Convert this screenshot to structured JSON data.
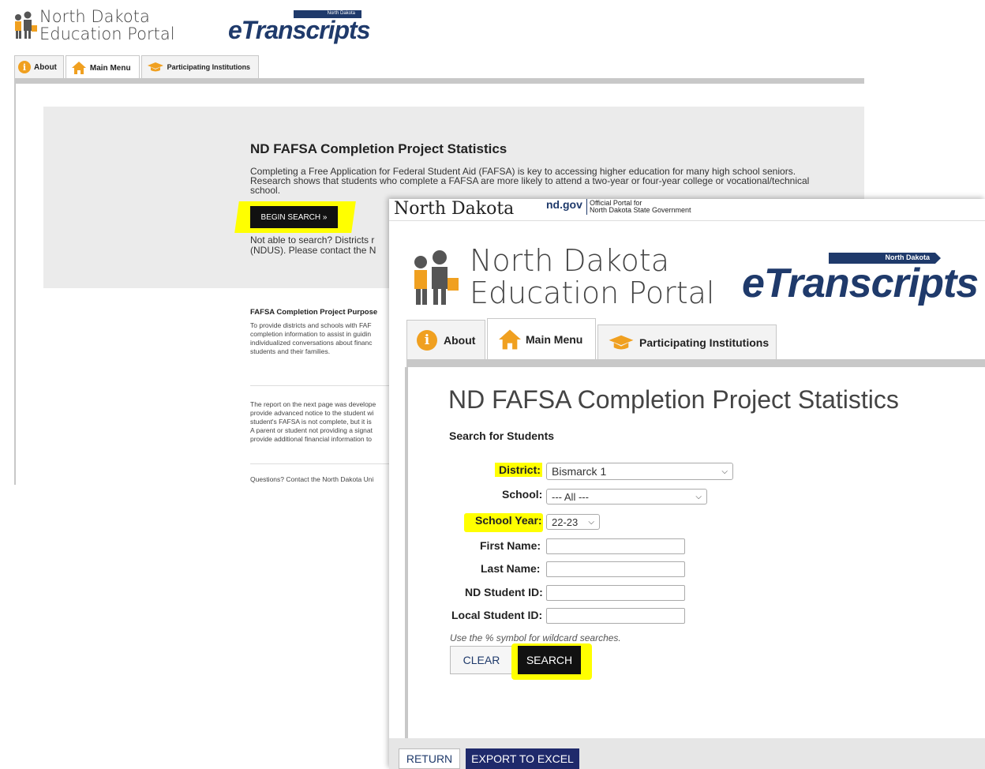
{
  "back": {
    "logo": {
      "line1": "North Dakota",
      "line2": "Education Portal",
      "etranscripts": "eTranscripts",
      "badge": "North Dakota"
    },
    "tabs": [
      {
        "label": "About",
        "icon": "info-icon"
      },
      {
        "label": "Main Menu",
        "icon": "house-icon"
      },
      {
        "label": "Participating Institutions",
        "icon": "graduation-cap-icon"
      }
    ],
    "title": "ND FAFSA Completion Project Statistics",
    "intro": "Completing a Free Application for Federal Student Aid (FAFSA) is key to accessing higher education for many high school seniors. Research shows that students who complete a FAFSA are more likely to attend a two-year or four-year college or vocational/technical school.",
    "begin_search": "BEGIN SEARCH »",
    "not_able_line1": "Not able to search? Districts r",
    "not_able_line2": "(NDUS). Please contact the N",
    "purpose_heading": "FAFSA Completion Project Purpose",
    "purpose_lines": [
      "To provide districts and schools with FAF",
      "completion information to assist in guidin",
      "individualized conversations about financ",
      "students and their families."
    ],
    "report_lines": [
      "The report on the next page was develope",
      "provide advanced notice to the student wi",
      "student's FAFSA is not complete, but it is",
      "A parent or student not providing a signat",
      "provide additional financial information to"
    ],
    "questions": "Questions? Contact the North Dakota Uni"
  },
  "front": {
    "topbar": {
      "state": "North Dakota",
      "ndgov": "nd.gov",
      "official1": "Official Portal for",
      "official2": "North Dakota State Government"
    },
    "logo": {
      "line1": "North Dakota",
      "line2": "Education Portal",
      "etranscripts": "eTranscripts",
      "badge": "North Dakota"
    },
    "tabs": [
      {
        "label": "About",
        "icon": "info-icon"
      },
      {
        "label": "Main Menu",
        "icon": "house-icon"
      },
      {
        "label": "Participating Institutions",
        "icon": "graduation-cap-icon"
      }
    ],
    "title": "ND FAFSA Completion Project Statistics",
    "subtitle": "Search for Students",
    "fields": {
      "district_label": "District:",
      "district_value": "Bismarck 1",
      "school_label": "School:",
      "school_value": "--- All ---",
      "year_label": "School Year:",
      "year_value": "22-23",
      "first_label": "First Name:",
      "last_label": "Last Name:",
      "ndid_label": "ND Student ID:",
      "localid_label": "Local Student ID:"
    },
    "wildcard_hint": "Use the % symbol for wildcard searches.",
    "clear_label": "CLEAR",
    "search_label": "SEARCH",
    "return_label": "RETURN",
    "export_label": "EXPORT TO EXCEL"
  },
  "colors": {
    "accent_orange": "#f0a020",
    "navy": "#1f3a6b",
    "highlight": "#ffff00",
    "button_dark": "#111111"
  }
}
